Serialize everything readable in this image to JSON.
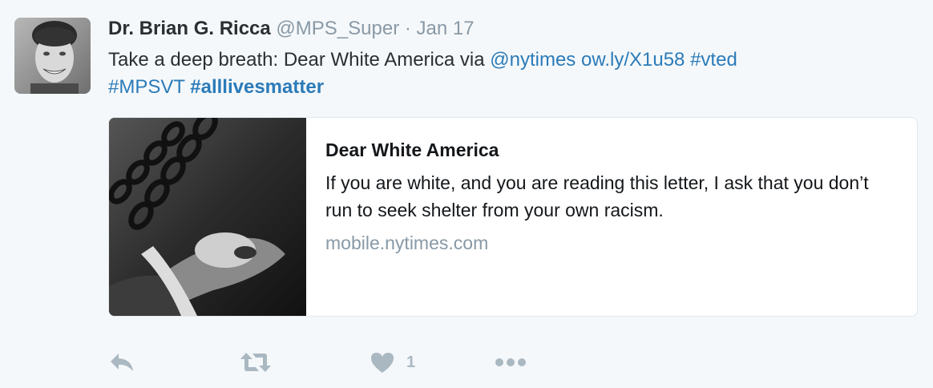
{
  "tweet": {
    "author": {
      "fullname": "Dr. Brian G. Ricca",
      "username": "@MPS_Super",
      "separator": "·",
      "date": "Jan 17"
    },
    "text": {
      "plain": "Take a deep breath: Dear White America via ",
      "mention": "@nytimes",
      "space1": " ",
      "url": "ow.ly/X1u58",
      "space2": " ",
      "hashtag1": "#vted",
      "space3": " ",
      "hashtag2": "#MPSVT",
      "space4": " ",
      "hashtag3": "#alllivesmatter"
    },
    "card": {
      "title": "Dear White America",
      "description": "If you are white, and you are reading this letter, I ask that you don’t run to seek shelter from your own racism.",
      "domain": "mobile.nytimes.com"
    },
    "actions": {
      "reply_icon": "reply-icon",
      "retweet_icon": "retweet-icon",
      "like_icon": "heart-icon",
      "like_count": "1",
      "more_icon": "more-icon"
    }
  },
  "colors": {
    "background": "#f5f8fa",
    "text": "#292f33",
    "muted": "#8899a6",
    "link": "#2b7bb9",
    "icon": "#aab8c2",
    "card_border": "#e1e8ed"
  }
}
